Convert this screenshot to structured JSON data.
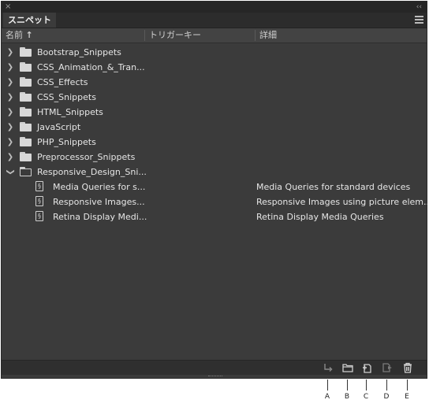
{
  "panel": {
    "tab_label": "スニペット",
    "close_glyph": "×",
    "collapse_glyph": "‹‹"
  },
  "columns": {
    "name": "名前",
    "sort_glyph": "↑",
    "trigger_key": "トリガーキー",
    "details": "詳細"
  },
  "folders": [
    {
      "label": "Bootstrap_Snippets",
      "expanded": false
    },
    {
      "label": "CSS_Animation_&_Tran...",
      "expanded": false
    },
    {
      "label": "CSS_Effects",
      "expanded": false
    },
    {
      "label": "CSS_Snippets",
      "expanded": false
    },
    {
      "label": "HTML_Snippets",
      "expanded": false
    },
    {
      "label": "JavaScript",
      "expanded": false
    },
    {
      "label": "PHP_Snippets",
      "expanded": false
    },
    {
      "label": "Preprocessor_Snippets",
      "expanded": false
    },
    {
      "label": "Responsive_Design_Sni...",
      "expanded": true
    }
  ],
  "snippets": [
    {
      "name": "Media Queries for s...",
      "description": "Media Queries for standard devices"
    },
    {
      "name": "Responsive Images...",
      "description": "Responsive Images using picture elem..."
    },
    {
      "name": "Retina Display Medi...",
      "description": "Retina Display Media Queries"
    }
  ],
  "footer_buttons": [
    {
      "icon": "insert-icon",
      "callout": "A"
    },
    {
      "icon": "new-folder-icon",
      "callout": "B"
    },
    {
      "icon": "new-snippet-icon",
      "callout": "C"
    },
    {
      "icon": "edit-snippet-icon",
      "callout": "D"
    },
    {
      "icon": "trash-icon",
      "callout": "E"
    }
  ],
  "colors": {
    "panel_bg": "#3b3b3b",
    "titlebar_bg": "#262626",
    "header_bg": "#434343",
    "text": "#e6e6e6"
  }
}
